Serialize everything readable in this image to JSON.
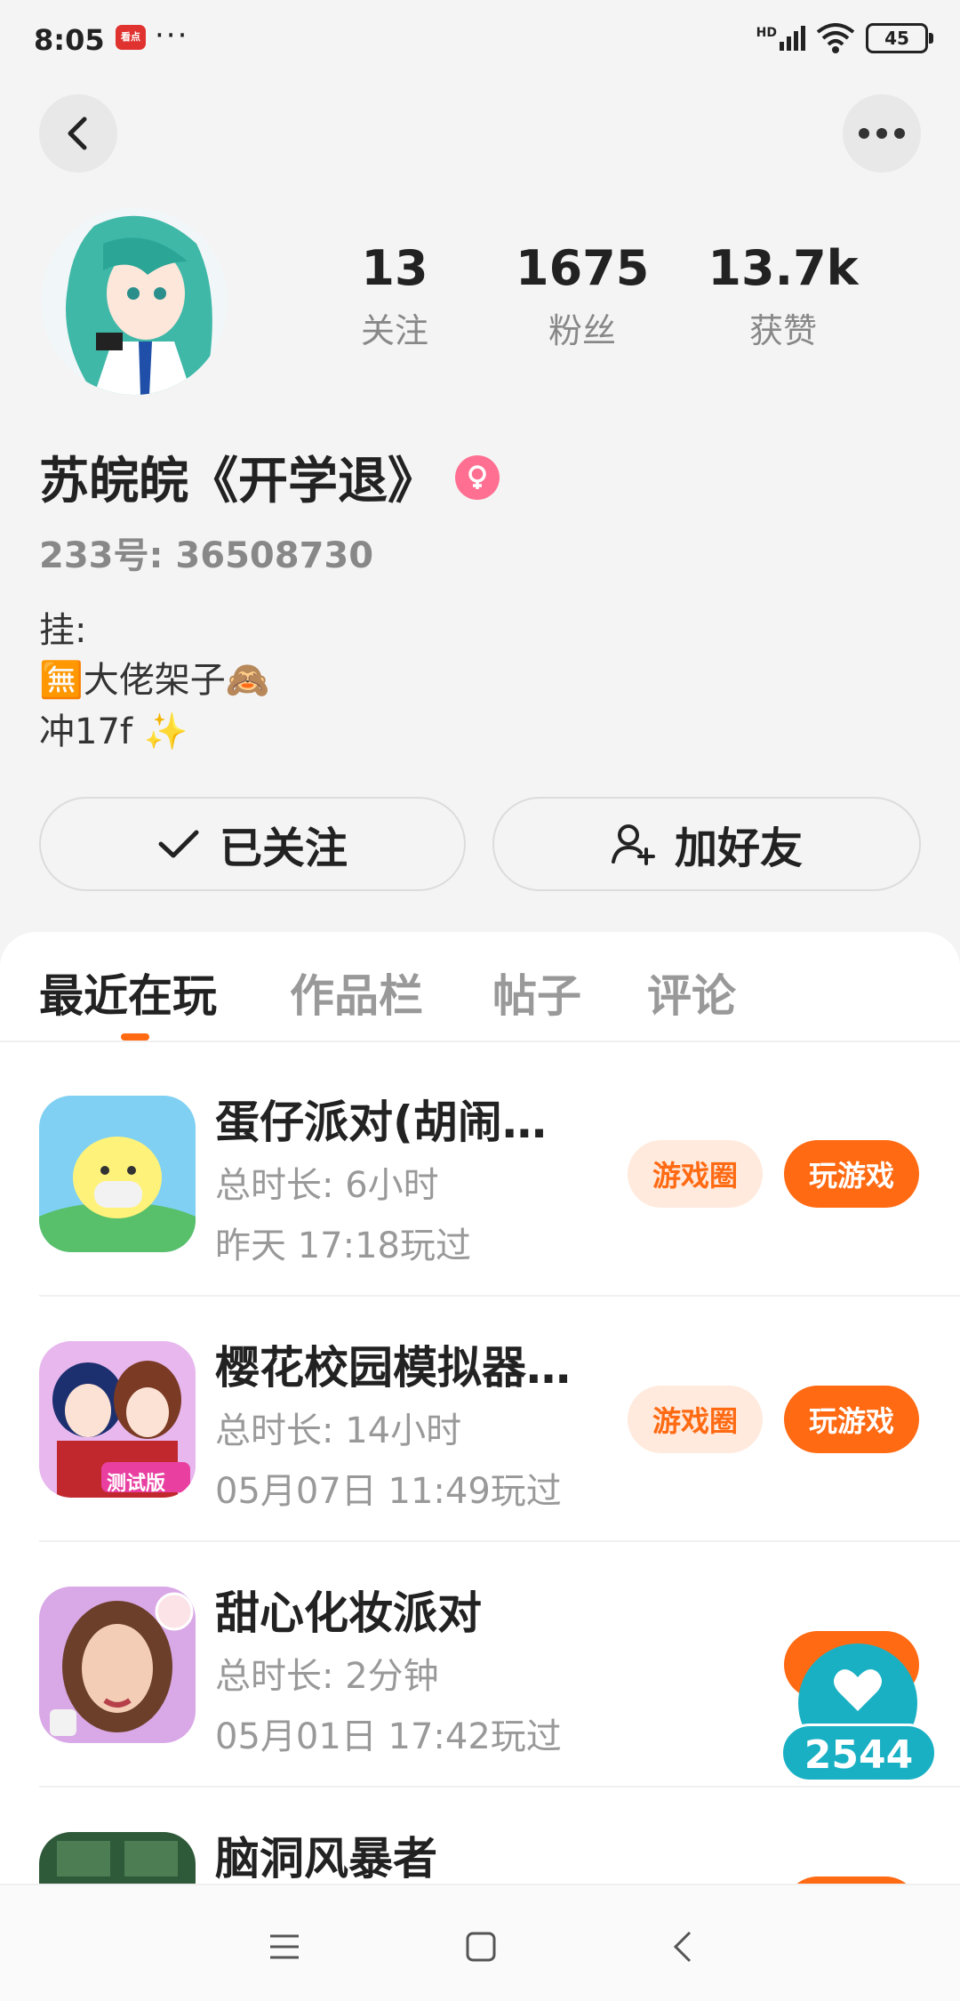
{
  "status": {
    "time": "8:05",
    "app_badge": "看点",
    "more": "···",
    "signal": "HD",
    "battery": "45"
  },
  "header": {
    "back_icon": "chevron-left-icon",
    "more_icon": "more-dots-icon"
  },
  "stats": [
    {
      "value": "13",
      "label": "关注"
    },
    {
      "value": "1675",
      "label": "粉丝"
    },
    {
      "value": "13.7k",
      "label": "获赞"
    }
  ],
  "profile": {
    "name": "苏皖皖《开学退》",
    "gender_icon": "female-icon",
    "uid": "233号: 36508730",
    "bio": [
      "挂:",
      "🈚大佬架子🙈",
      "冲17f ✨"
    ]
  },
  "actions": {
    "followed": "已关注",
    "add_friend": "加好友"
  },
  "tabs": [
    "最近在玩",
    "作品栏",
    "帖子",
    "评论"
  ],
  "games": [
    {
      "title": "蛋仔派对(胡闹…",
      "duration": "总时长: 6小时",
      "last_played": "昨天 17:18玩过",
      "circle": "游戏圈",
      "play": "玩游戏"
    },
    {
      "title": "樱花校园模拟器…",
      "duration": "总时长: 14小时",
      "last_played": "05月07日 11:49玩过",
      "circle": "游戏圈",
      "play": "玩游戏"
    },
    {
      "title": "甜心化妆派对",
      "duration": "总时长: 2分钟",
      "last_played": "05月01日 17:42玩过",
      "circle": "",
      "play": ""
    },
    {
      "title": "脑洞风暴者",
      "duration": "",
      "last_played": "",
      "circle": "",
      "play": ""
    }
  ],
  "game_icons": {
    "g2_badge": "测试版"
  },
  "floating_like": {
    "count": "2544",
    "icon": "heart-icon"
  },
  "navbar": {
    "menu_icon": "menu-icon",
    "home_icon": "home-square-icon",
    "back_icon": "back-triangle-icon"
  },
  "colors": {
    "accent": "#ff6a13",
    "like": "#1ab0c4",
    "gender": "#ff6f91"
  }
}
